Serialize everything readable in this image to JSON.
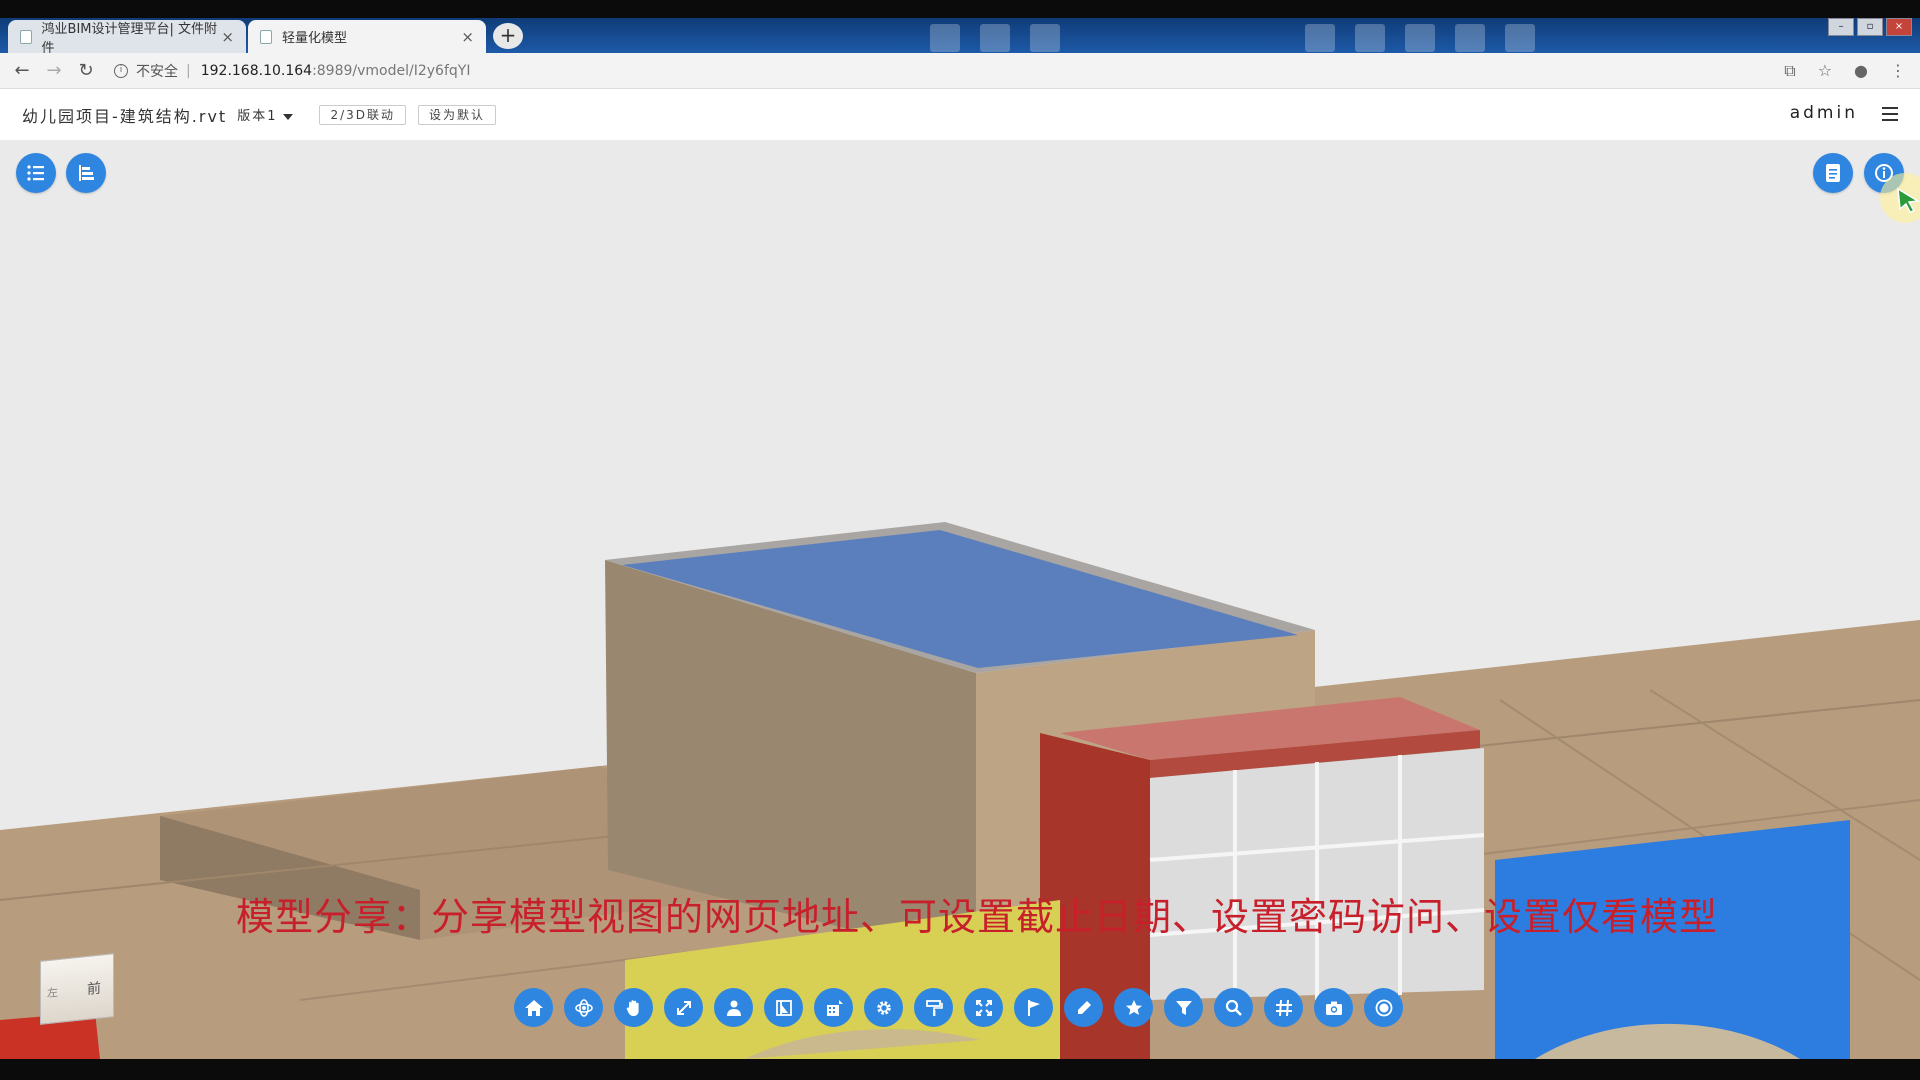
{
  "browser": {
    "tabs": [
      {
        "title": "鸿业BIM设计管理平台| 文件附件",
        "close": "×",
        "active": false
      },
      {
        "title": "轻量化模型",
        "close": "×",
        "active": true
      }
    ],
    "new_tab": "+",
    "security_label": "不安全",
    "url_host": "192.168.10.164",
    "url_path": ":8989/vmodel/I2y6fqYI",
    "window_controls": [
      "–",
      "▫",
      "×"
    ]
  },
  "header": {
    "title": "幼儿园项目-建筑结构.rvt",
    "version": "版本1",
    "sync_button": "2/3D联动",
    "default_button": "设为默认",
    "user": "admin"
  },
  "viewer": {
    "left_buttons": [
      {
        "name": "list-icon"
      },
      {
        "name": "tree-icon"
      }
    ],
    "right_buttons": [
      {
        "name": "document-icon"
      },
      {
        "name": "info-icon"
      }
    ],
    "caption": "模型分享：分享模型视图的网页地址、可设置截止日期、设置密码访问、设置仅看模型",
    "viewcube_front": "前",
    "viewcube_left": "左",
    "toolbar": [
      {
        "name": "home-icon"
      },
      {
        "name": "orbit-icon"
      },
      {
        "name": "pan-hand-icon"
      },
      {
        "name": "zoom-fit-icon"
      },
      {
        "name": "person-walk-icon"
      },
      {
        "name": "section-icon"
      },
      {
        "name": "building-icon"
      },
      {
        "name": "settings-gear-icon"
      },
      {
        "name": "paint-roller-icon"
      },
      {
        "name": "fullscreen-icon"
      },
      {
        "name": "flag-icon"
      },
      {
        "name": "pencil-icon"
      },
      {
        "name": "star-icon"
      },
      {
        "name": "filter-icon"
      },
      {
        "name": "search-icon"
      },
      {
        "name": "grid-hash-icon"
      },
      {
        "name": "camera-icon"
      },
      {
        "name": "record-icon"
      }
    ],
    "colors": {
      "toolbar_blue": "#2f86e0",
      "caption_red": "#c8202b",
      "wall_tan": "#9a8770",
      "roof_blue": "#5b7fbd",
      "red_frame": "#a8352a",
      "panel_blue": "#2d7de0"
    }
  }
}
